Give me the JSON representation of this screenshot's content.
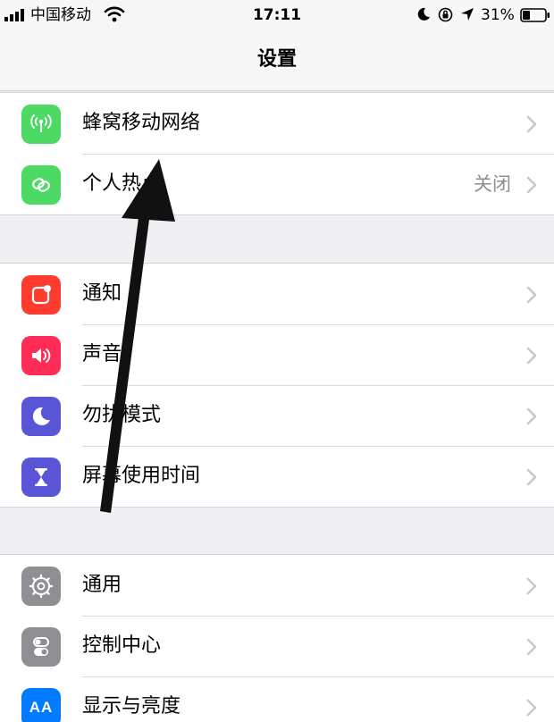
{
  "status_bar": {
    "carrier": "中国移动",
    "time": "17:11",
    "battery": "31%"
  },
  "nav": {
    "title": "设置"
  },
  "groups": [
    {
      "items": [
        {
          "label": "蜂窝移动网络",
          "icon": "cellular-antenna-icon",
          "color": "#4cd964"
        },
        {
          "label": "个人热点",
          "value": "关闭",
          "icon": "hotspot-link-icon",
          "color": "#4cd964"
        }
      ]
    },
    {
      "items": [
        {
          "label": "通知",
          "icon": "notifications-icon",
          "color": "#ff3b30"
        },
        {
          "label": "声音",
          "icon": "speaker-icon",
          "color": "#ff2d55"
        },
        {
          "label": "勿扰模式",
          "icon": "moon-icon",
          "color": "#5856d6"
        },
        {
          "label": "屏幕使用时间",
          "icon": "hourglass-icon",
          "color": "#5856d6"
        }
      ]
    },
    {
      "items": [
        {
          "label": "通用",
          "icon": "gear-icon",
          "color": "#8e8e93"
        },
        {
          "label": "控制中心",
          "icon": "toggles-icon",
          "color": "#8e8e93"
        },
        {
          "label": "显示与亮度",
          "icon": "text-size-icon",
          "color": "#007aff",
          "icon_text": "AA"
        }
      ]
    }
  ],
  "colors": {
    "background": "#efeff4",
    "chevron": "#c7c7cc",
    "annotation_arrow": "#111111"
  }
}
